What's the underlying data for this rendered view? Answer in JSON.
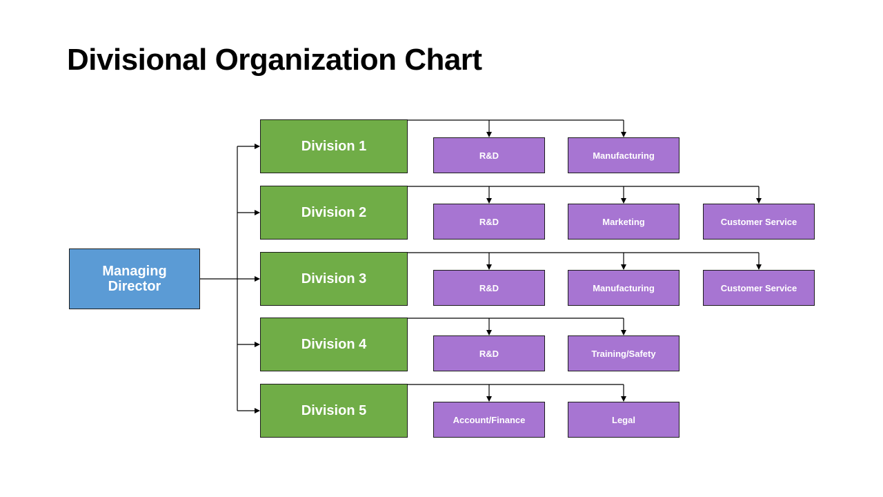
{
  "title": "Divisional Organization Chart",
  "colors": {
    "root": "#5b9bd5",
    "division": "#70ad47",
    "department": "#a775d2",
    "connector": "#000000"
  },
  "root": {
    "label": "Managing Director"
  },
  "divisions": [
    {
      "label": "Division 1",
      "departments": [
        "R&D",
        "Manufacturing"
      ]
    },
    {
      "label": "Division 2",
      "departments": [
        "R&D",
        "Marketing",
        "Customer Service"
      ]
    },
    {
      "label": "Division 3",
      "departments": [
        "R&D",
        "Manufacturing",
        "Customer Service"
      ]
    },
    {
      "label": "Division 4",
      "departments": [
        "R&D",
        "Training/Safety"
      ]
    },
    {
      "label": "Division 5",
      "departments": [
        "Account/Finance",
        "Legal"
      ]
    }
  ]
}
